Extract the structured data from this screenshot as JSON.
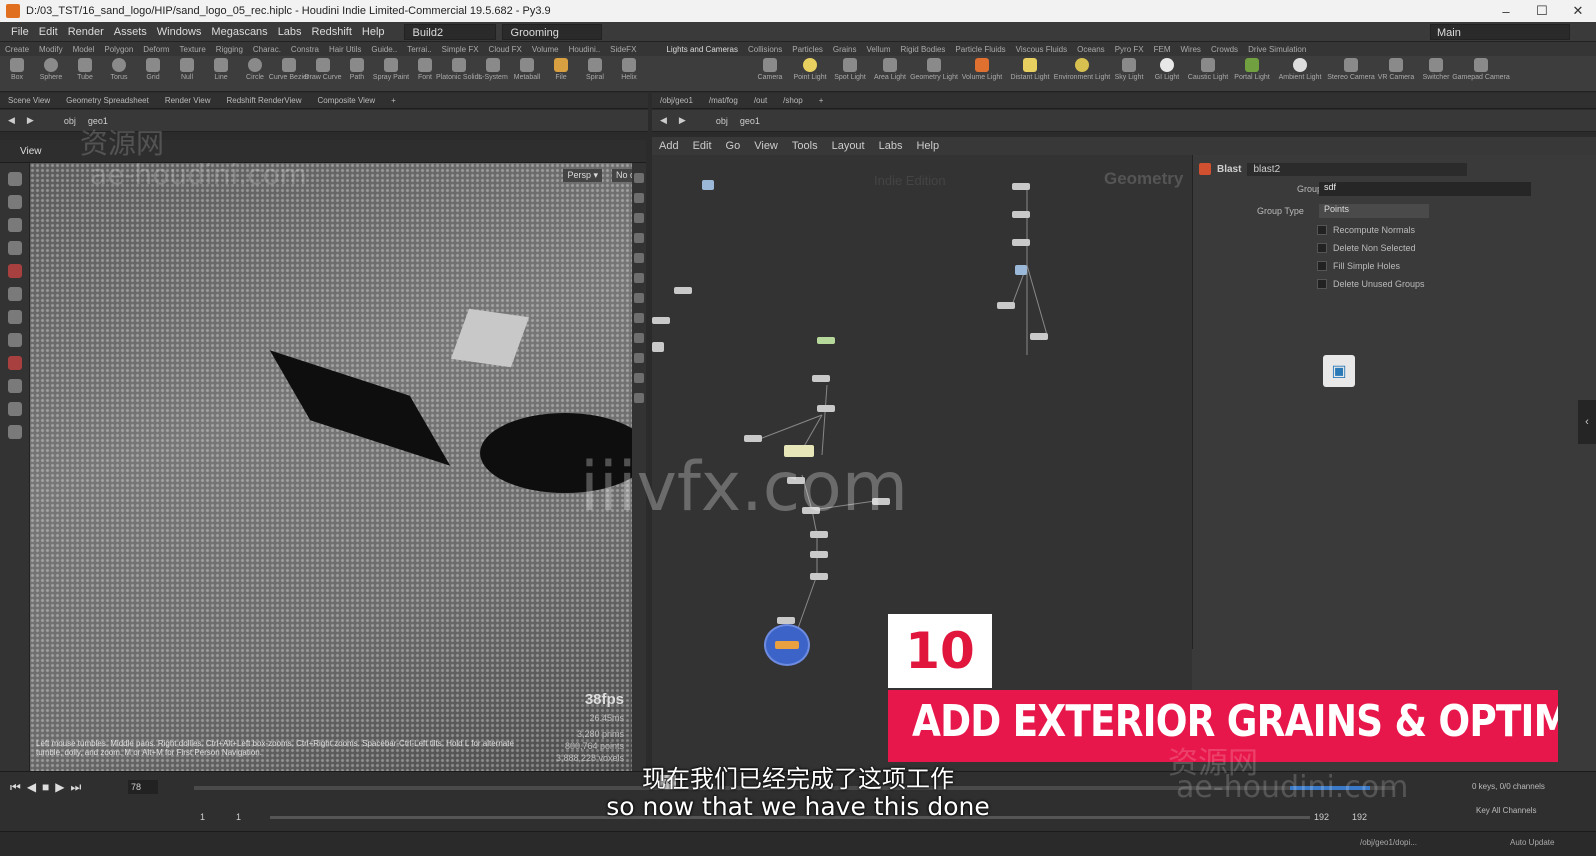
{
  "window": {
    "title": "D:/03_TST/16_sand_logo/HIP/sand_logo_05_rec.hiplc - Houdini Indie Limited-Commercial 19.5.682 - Py3.9",
    "minimize": "–",
    "maximize": "☐",
    "close": "✕"
  },
  "menu": {
    "items": [
      "File",
      "Edit",
      "Render",
      "Assets",
      "Windows",
      "Megascans",
      "Labs",
      "Redshift",
      "Help"
    ],
    "desktop": "Build2",
    "context": "Grooming",
    "right": "Main"
  },
  "shelf_tabs": [
    "Create",
    "Modify",
    "Model",
    "Polygon",
    "Deform",
    "Texture",
    "Rigging",
    "Charac.",
    "Constra",
    "Hair Utils",
    "Guide..",
    "Terrai..",
    "Simple FX",
    "Cloud FX",
    "Volume",
    "Houdini..",
    "SideFX",
    "Lights and Cameras",
    "Collisions",
    "Particles",
    "Grains",
    "Vellum",
    "Rigid Bodies",
    "Particle Fluids",
    "Viscous Fluids",
    "Oceans",
    "Pyro FX",
    "FEM",
    "Wires",
    "Crowds",
    "Drive Simulation"
  ],
  "left_tools": [
    "Box",
    "Sphere",
    "Tube",
    "Torus",
    "Grid",
    "Null",
    "Line",
    "Circle",
    "Curve Bezier",
    "Draw Curve",
    "Path",
    "Spray Paint",
    "Font",
    "Platonic Solids",
    "L-System",
    "Metaball",
    "File",
    "Spiral",
    "Helix"
  ],
  "right_tools": [
    "Camera",
    "Point Light",
    "Spot Light",
    "Area Light",
    "Geometry Light",
    "Volume Light",
    "Distant Light",
    "Environment Light",
    "Sky Light",
    "GI Light",
    "Caustic Light",
    "Portal Light",
    "Ambient Light",
    "Stereo Camera",
    "VR Camera",
    "Switcher",
    "Gamepad Camera"
  ],
  "left_pane": {
    "tabs": [
      "Scene View",
      "Geometry Spreadsheet",
      "Render View",
      "Redshift RenderView",
      "Composite View"
    ],
    "path": [
      "obj",
      "geo1"
    ],
    "view_label": "View",
    "persp": "Persp ▾",
    "cam": "No cam ▾",
    "fps": "38fps",
    "time_ms": "26.45ms",
    "stats": [
      "3,280 prims",
      "800,764 points",
      "3,888,228 voxels"
    ],
    "help": "Left mouse tumbles. Middle pans. Right dollies. Ctrl+Alt+Left box-zooms. Ctrl+Right zooms. Spacebar-Ctrl-Left tilts. Hold L for alternate tumble, dolly, and zoom.    M or Alt+M for First Person Navigation."
  },
  "right_pane": {
    "tabs": [
      "/obj/geo1",
      "/mat/fog",
      "/out",
      "/shop"
    ],
    "path": [
      "obj",
      "geo1"
    ],
    "menu": [
      "Add",
      "Edit",
      "Go",
      "View",
      "Tools",
      "Layout",
      "Labs",
      "Help"
    ],
    "context_label": "Geometry",
    "network_label": "Indie Edition"
  },
  "params": {
    "node_type": "Blast",
    "node_name": "blast2",
    "group_label": "Group",
    "group_value": "sdf",
    "group_type_label": "Group Type",
    "group_type_value": "Points",
    "checkboxes": [
      "Recompute Normals",
      "Delete Non Selected",
      "Fill Simple Holes",
      "Delete Unused Groups"
    ]
  },
  "timeline": {
    "frame": "78",
    "start": "1",
    "start2": "1",
    "end": "192",
    "end2": "192",
    "marker": "78",
    "keys": "0 keys, 0/0 channels",
    "key_all": "Key All Channels",
    "auto_update": "Auto Update",
    "status_path": "/obj/geo1/dopi..."
  },
  "overlay": {
    "number": "10",
    "banner": "ADD EXTERIOR GRAINS & OPTIMIZE",
    "subtitle_cn": "现在我们已经完成了这项工作",
    "subtitle_en": "so now that we have this done",
    "watermark_cn": "资源网",
    "watermark_en": "ae-houdini.com",
    "watermark_center": "iiivfx.com"
  },
  "colors": {
    "banner": "#e8174b",
    "number_text": "#e0163c"
  }
}
